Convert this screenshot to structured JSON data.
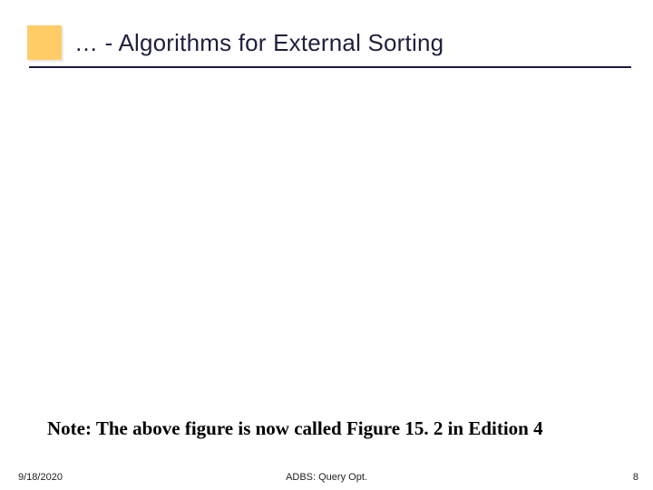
{
  "header": {
    "title": "… - Algorithms for External Sorting"
  },
  "body": {
    "note": "Note: The above figure is now called Figure 15. 2 in Edition 4"
  },
  "footer": {
    "date": "9/18/2020",
    "center": "ADBS: Query Opt.",
    "page": "8"
  }
}
